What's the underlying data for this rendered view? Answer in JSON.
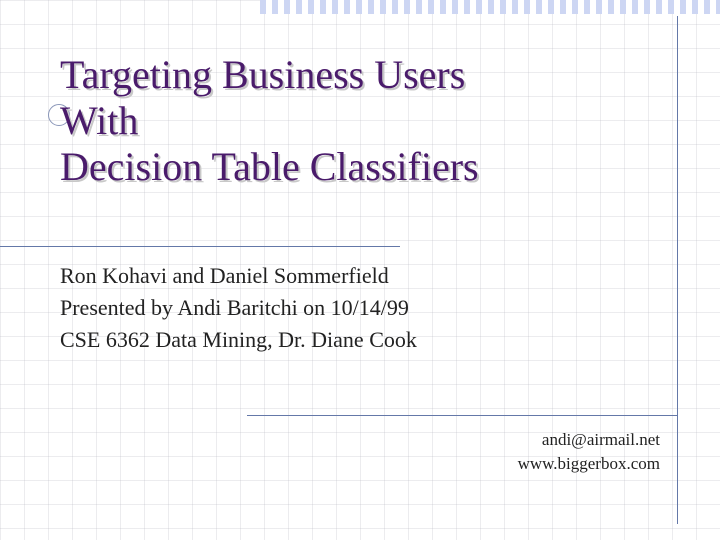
{
  "title": {
    "line1": "Targeting Business Users",
    "line2": "With",
    "line3": "Decision Table Classifiers"
  },
  "body": {
    "authors": "Ron Kohavi and Daniel Sommerfield",
    "presented": "Presented by Andi Baritchi on 10/14/99",
    "course": "CSE 6362 Data Mining, Dr. Diane Cook"
  },
  "footer": {
    "email": "andi@airmail.net",
    "url": "www.biggerbox.com"
  }
}
